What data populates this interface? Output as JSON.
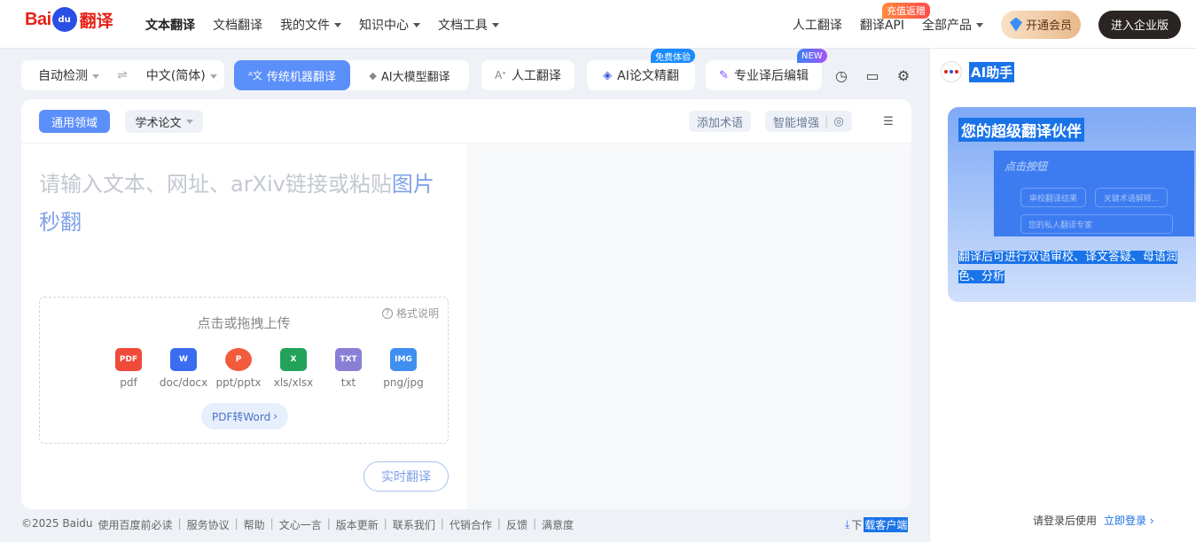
{
  "brand": {
    "logo_left": "Bai",
    "logo_mid": "du",
    "logo_right": "翻译"
  },
  "nav": {
    "left": [
      "文本翻译",
      "文档翻译",
      "我的文件",
      "知识中心",
      "文档工具"
    ],
    "right": {
      "human": "人工翻译",
      "api": "翻译API",
      "all": "全部产品",
      "topup_badge": "充值返赠",
      "vip": "开通会员",
      "enterprise": "进入企业版"
    }
  },
  "lang": {
    "source": "自动检测",
    "swap": "⇌",
    "target": "中文(简体)"
  },
  "modes": {
    "traditional": "传统机器翻译",
    "llm": "AI大模型翻译"
  },
  "tools": {
    "human_translation": "人工翻译",
    "paper_polish": "AI论文精翻",
    "paper_badge": "免费体验",
    "post_edit": "专业译后编辑",
    "post_edit_badge": "NEW"
  },
  "domain": {
    "general": "通用领域",
    "academic": "学术论文"
  },
  "card_actions": {
    "add_term": "添加术语",
    "smart": "智能增强"
  },
  "input": {
    "placeholder_main": "请输入文本、网址、arXiv链接或粘贴",
    "placeholder_hl": "图片",
    "placeholder_end": "秒翻"
  },
  "upload": {
    "title": "点击或拖拽上传",
    "format_help": "格式说明",
    "types": [
      "pdf",
      "doc/docx",
      "ppt/pptx",
      "xls/xlsx",
      "txt",
      "png/jpg"
    ],
    "pdf_to_word": "PDF转Word"
  },
  "realtime": "实时翻译",
  "footer": {
    "links": [
      "©2025 Baidu",
      "使用百度前必读",
      "服务协议",
      "帮助",
      "文心一言",
      "版本更新",
      "联系我们",
      "代销合作",
      "反馈",
      "满意度"
    ],
    "download_prefix": "下",
    "download_hl": "载客户端"
  },
  "ai": {
    "title": "AI助手",
    "promo_title": "您的超级翻译伙伴",
    "promo_img_title": "点击按钮",
    "promo_btn1": "审校翻译结果",
    "promo_btn2": "关键术语解释...",
    "promo_btn3": "您的私人翻译专家",
    "promo_desc": "翻译后可进行双语审校、译文答疑、母语润色、分析",
    "login_text": "请登录后使用",
    "login_link": "立即登录 ›"
  },
  "colors": {
    "accent": "#5b8ff9",
    "brand_red": "#e62117",
    "highlight": "#1a73e8"
  }
}
